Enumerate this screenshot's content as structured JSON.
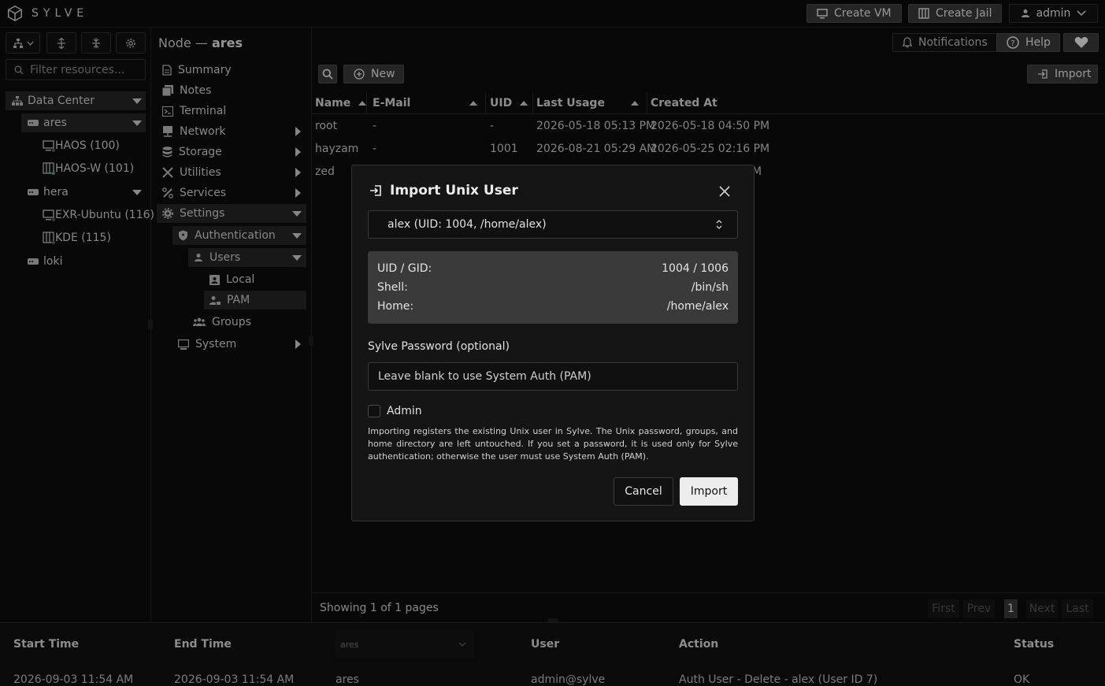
{
  "app": {
    "brand": "SYLVE"
  },
  "topbar": {
    "create_vm": "Create VM",
    "create_jail": "Create Jail",
    "user": "admin"
  },
  "header": {
    "node_prefix": "Node — ",
    "node_name": "ares",
    "notifications": "Notifications",
    "help": "Help"
  },
  "sidebar": {
    "filter_placeholder": "Filter resources...",
    "tree": {
      "datacenter": "Data Center",
      "ares": "ares",
      "haos": "HAOS (100)",
      "haos_w": "HAOS-W (101)",
      "hera": "hera",
      "exr": "EXR-Ubuntu (116)",
      "kde": "KDE (115)",
      "loki": "loki"
    }
  },
  "nav": {
    "summary": "Summary",
    "notes": "Notes",
    "terminal": "Terminal",
    "network": "Network",
    "storage": "Storage",
    "utilities": "Utilities",
    "services": "Services",
    "settings": "Settings",
    "authentication": "Authentication",
    "users": "Users",
    "local": "Local",
    "pam": "PAM",
    "groups": "Groups",
    "system": "System"
  },
  "toolbar": {
    "new_label": "New",
    "import_label": "Import"
  },
  "table": {
    "columns": [
      "Name",
      "E-Mail",
      "UID",
      "Last Usage",
      "Created At"
    ],
    "rows": [
      {
        "name": "root",
        "email": "-",
        "uid": "-",
        "last": "2026-05-18 05:13 PM",
        "created": "2026-05-18 04:50 PM"
      },
      {
        "name": "hayzam",
        "email": "-",
        "uid": "1001",
        "last": "2026-08-21 05:29 AM",
        "created": "2026-05-25 02:16 PM"
      },
      {
        "name": "zed",
        "email": "",
        "uid": "",
        "last": "",
        "created": "M"
      }
    ]
  },
  "pagination": {
    "summary": "Showing 1 of 1 pages",
    "first": "First",
    "prev": "Prev",
    "page": "1",
    "next": "Next",
    "last": "Last"
  },
  "audit": {
    "headers": {
      "start": "Start Time",
      "end": "End Time",
      "node_filter": "ares",
      "user": "User",
      "action": "Action",
      "status": "Status"
    },
    "row": {
      "start": "2026-09-03 11:54 AM",
      "end": "2026-09-03 11:54 AM",
      "node": "ares",
      "user": "admin@sylve",
      "action": "Auth User - Delete - alex (User ID 7)",
      "status": "OK"
    }
  },
  "modal": {
    "title": "Import Unix User",
    "selected_user": "alex (UID: 1004, /home/alex)",
    "info": [
      {
        "label": "UID / GID:",
        "value": "1004 / 1006"
      },
      {
        "label": "Shell:",
        "value": "/bin/sh"
      },
      {
        "label": "Home:",
        "value": "/home/alex"
      }
    ],
    "password_label": "Sylve Password (optional)",
    "password_placeholder": "Leave blank to use System Auth (PAM)",
    "admin_label": "Admin",
    "admin_checked": false,
    "help_text": "Importing registers the existing Unix user in Sylve. The Unix password, groups, and home directory are left untouched. If you set a password, it is used only for Sylve authentication; otherwise the user must use System Auth (PAM).",
    "cancel": "Cancel",
    "import": "Import"
  }
}
